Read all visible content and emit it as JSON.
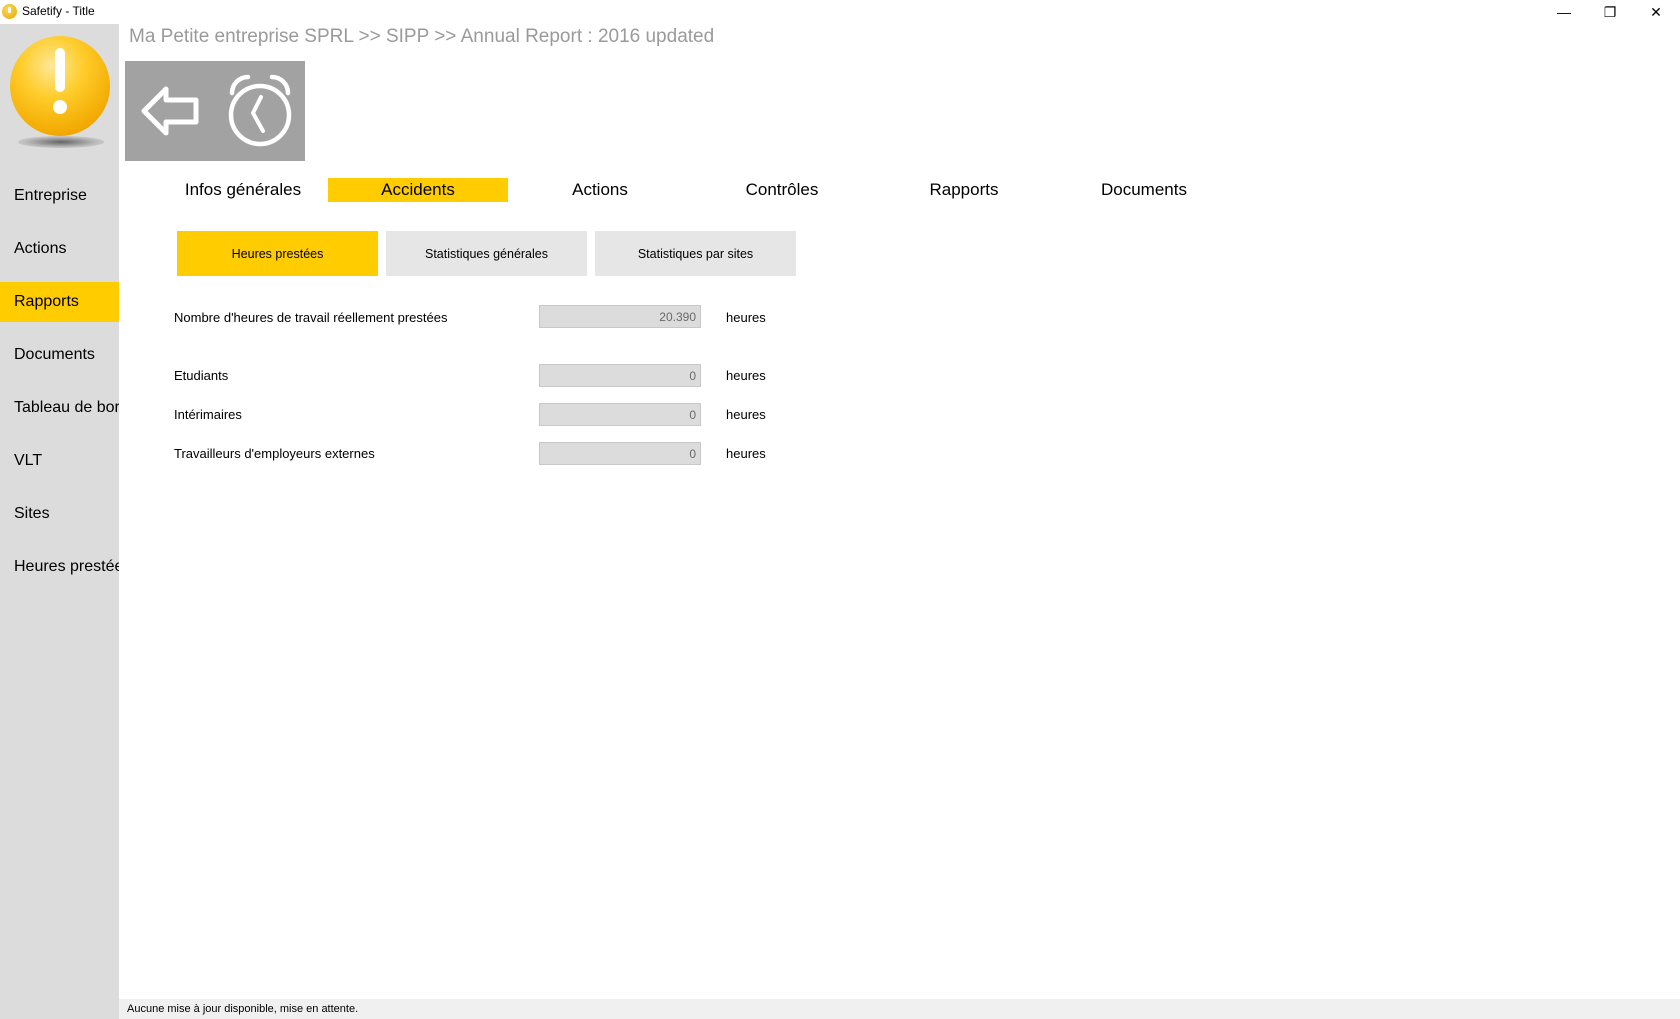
{
  "window": {
    "title": "Safetify - Title",
    "minimize": "—",
    "restore": "❐",
    "close": "✕"
  },
  "breadcrumb": "Ma Petite entreprise SPRL >> SIPP >> Annual Report : 2016 updated",
  "sidebar": {
    "logo_icon": "warning-exclamation-icon",
    "items": [
      {
        "label": "Entreprise",
        "active": false
      },
      {
        "label": "Actions",
        "active": false
      },
      {
        "label": "Rapports",
        "active": true
      },
      {
        "label": "Documents",
        "active": false
      },
      {
        "label": "Tableau de bord",
        "active": false
      },
      {
        "label": "VLT",
        "active": false
      },
      {
        "label": "Sites",
        "active": false
      },
      {
        "label": "Heures prestées",
        "active": false
      }
    ]
  },
  "toolbar": {
    "back_icon": "back-arrow-icon",
    "clock_icon": "stopwatch-icon"
  },
  "tabs": [
    {
      "label": "Infos générales",
      "active": false
    },
    {
      "label": "Accidents",
      "active": true
    },
    {
      "label": "Actions",
      "active": false
    },
    {
      "label": "Contrôles",
      "active": false
    },
    {
      "label": "Rapports",
      "active": false
    },
    {
      "label": "Documents",
      "active": false
    }
  ],
  "subtabs": [
    {
      "label": "Heures prestées",
      "active": true
    },
    {
      "label": "Statistiques générales",
      "active": false
    },
    {
      "label": "Statistiques par sites",
      "active": false
    }
  ],
  "form": {
    "rows": [
      {
        "label": "Nombre d'heures de travail réellement prestées",
        "value": "20.390",
        "unit": "heures"
      },
      {
        "label": "Etudiants",
        "value": "0",
        "unit": "heures"
      },
      {
        "label": "Intérimaires",
        "value": "0",
        "unit": "heures"
      },
      {
        "label": "Travailleurs d'employeurs externes",
        "value": "0",
        "unit": "heures"
      }
    ]
  },
  "status": "Aucune mise à jour disponible, mise en attente.",
  "colors": {
    "accent": "#ffcc00",
    "sidebar_bg": "#dcdcdc",
    "tile_bg": "#a2a2a2",
    "breadcrumb": "#9a9a9a"
  }
}
